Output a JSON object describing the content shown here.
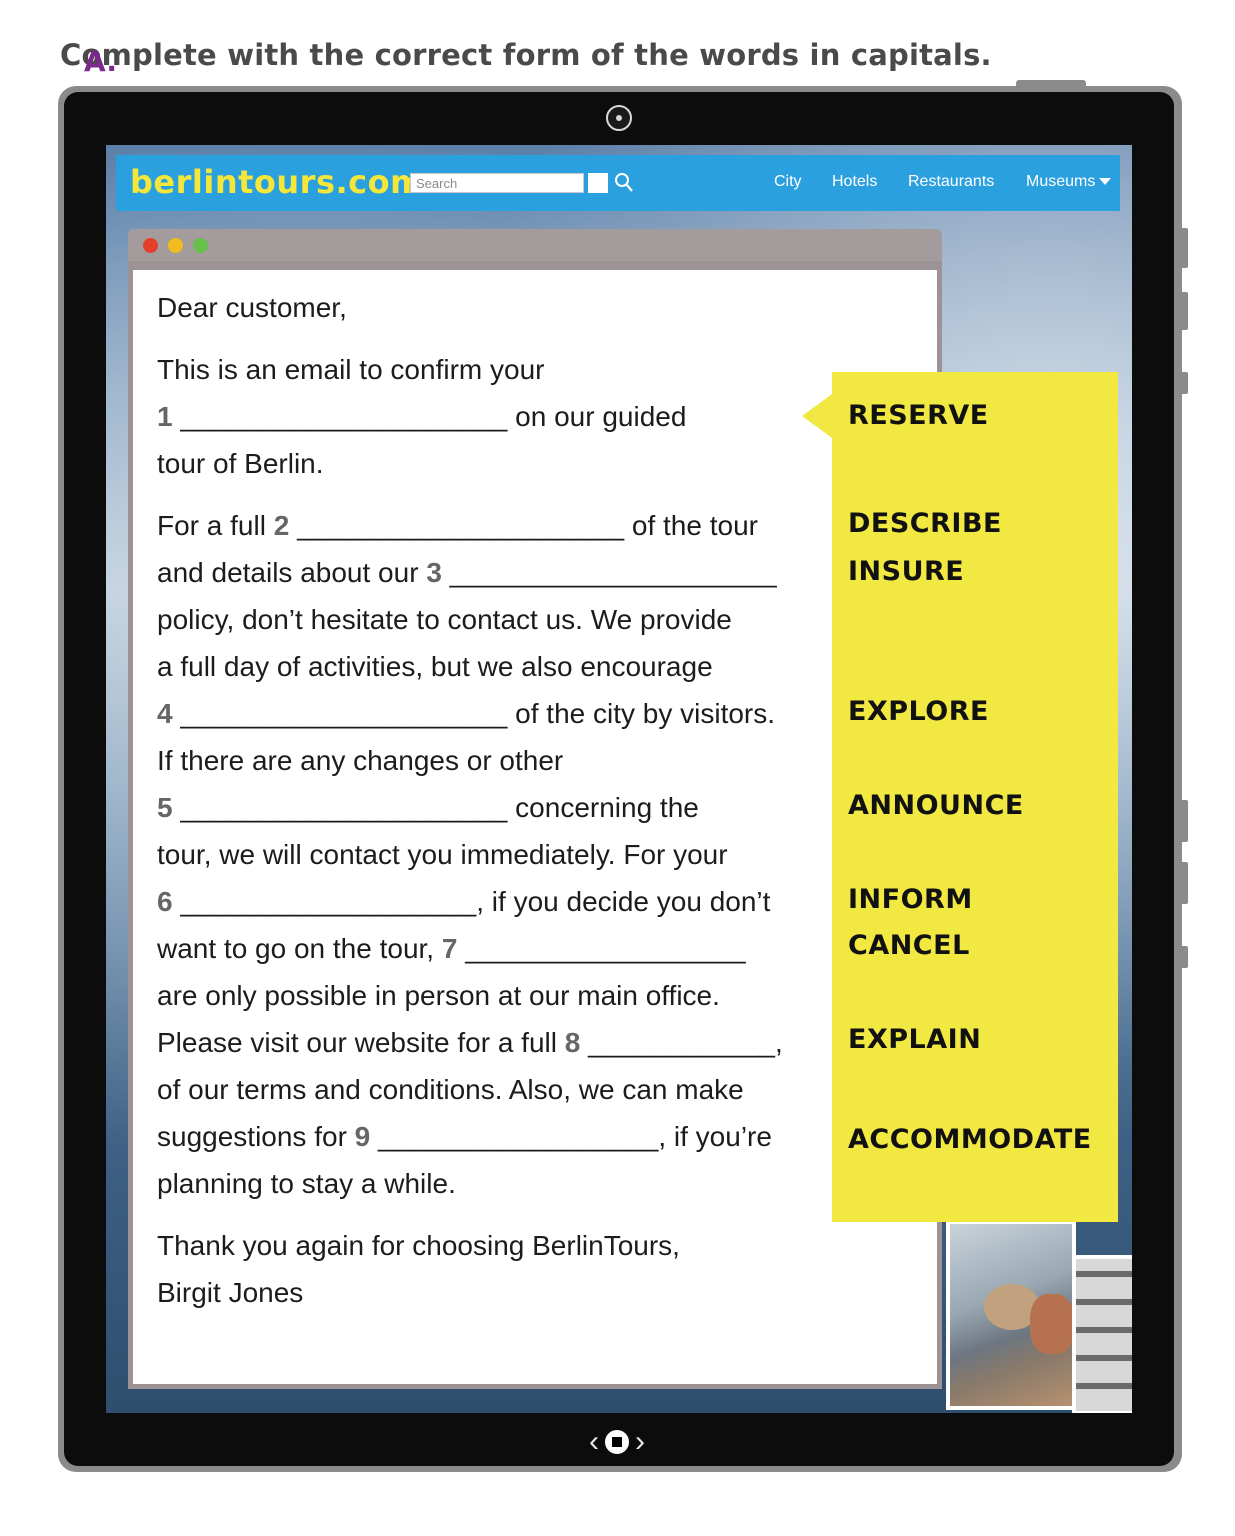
{
  "instruction": {
    "letter": "A.",
    "text": "Complete with the correct form of the words in capitals."
  },
  "website": {
    "logo": "berlintours.com",
    "search_placeholder": "Search",
    "nav": [
      "City",
      "Hotels",
      "Restaurants",
      "Museums"
    ],
    "brand_color": "#2aa0de",
    "logo_color": "#f5e63a"
  },
  "email": {
    "greeting": "Dear customer,",
    "l1": "This is an email to confirm your",
    "n1": "1",
    "b1": "_____________________",
    "l2": "on our guided",
    "l3": "tour of Berlin.",
    "l4a": "For a full",
    "n2": "2",
    "b2": "_____________________",
    "l4b": "of the tour",
    "l5a": "and details about our",
    "n3": "3",
    "b3": "_____________________",
    "l6": "policy, don’t hesitate to contact us. We provide",
    "l7": "a full day of activities, but we also encourage",
    "n4": "4",
    "b4": "_____________________",
    "l8": "of the city by visitors.",
    "l9": "If there are any changes or other",
    "n5": "5",
    "b5": "_____________________",
    "l10": "concerning the",
    "l11": "tour, we will contact you immediately. For your",
    "n6": "6",
    "b6": "___________________",
    "l12": ", if you decide you don’t",
    "l13a": "want to go on the tour,",
    "n7": "7",
    "b7": "__________________",
    "l14": "are only possible in person at our main office.",
    "l15a": "Please visit our website for a full",
    "n8": "8",
    "b8": "____________",
    "l15b": ",",
    "l16": "of our terms and conditions. Also, we can make",
    "l17a": "suggestions for",
    "n9": "9",
    "b9": "__________________",
    "l17b": ", if you’re",
    "l18": "planning to stay a while.",
    "closing": "Thank you again for choosing BerlinTours,",
    "signature": "Birgit Jones"
  },
  "words": {
    "w1": "RESERVE",
    "w2": "DESCRIBE",
    "w3": "INSURE",
    "w4": "EXPLORE",
    "w5": "ANNOUNCE",
    "w6": "INFORM",
    "w7": "CANCEL",
    "w8": "EXPLAIN",
    "w9": "ACCOMMODATE",
    "panel_color": "#f2e842"
  }
}
